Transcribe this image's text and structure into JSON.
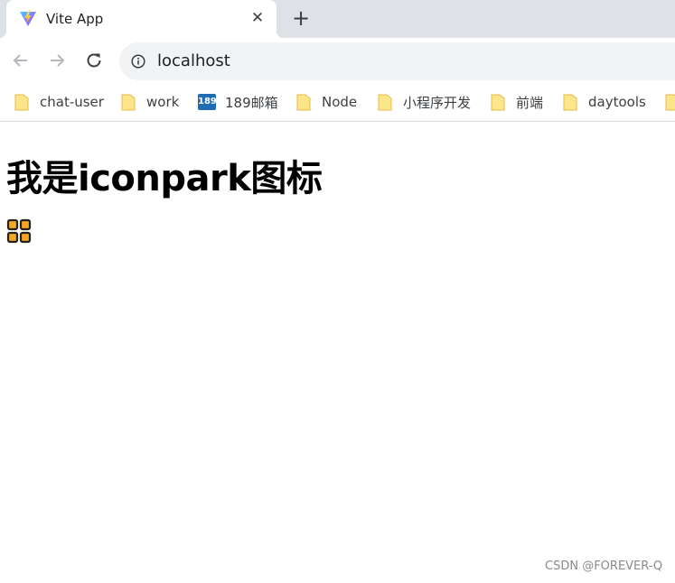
{
  "tab": {
    "title": "Vite App",
    "close_glyph": "✕",
    "new_tab_glyph": "+",
    "favicon": "vite-logo-icon"
  },
  "toolbar": {
    "url": "localhost",
    "icons": [
      "back-arrow-icon",
      "forward-arrow-icon",
      "reload-icon",
      "info-icon"
    ]
  },
  "bookmarks": [
    {
      "label": "chat-user",
      "icon": "folder-icon"
    },
    {
      "label": "work",
      "icon": "folder-icon"
    },
    {
      "label": "189邮箱",
      "icon": "189-mail-icon",
      "badge": "189"
    },
    {
      "label": "Node",
      "icon": "folder-icon"
    },
    {
      "label": "小程序开发",
      "icon": "folder-icon"
    },
    {
      "label": "前端",
      "icon": "folder-icon"
    },
    {
      "label": "daytools",
      "icon": "folder-icon"
    }
  ],
  "page": {
    "heading": "我是iconpark图标",
    "icon": "application-grid-icon"
  },
  "watermark": "CSDN @FOREVER-Q",
  "colors": {
    "tabstrip": "#dee1e6",
    "omnibox": "#f1f3f4",
    "folder": "#f7d774",
    "icon_fill": "#f5a623",
    "icon_stroke": "#222222",
    "mail_badge": "#1f6bb5"
  }
}
